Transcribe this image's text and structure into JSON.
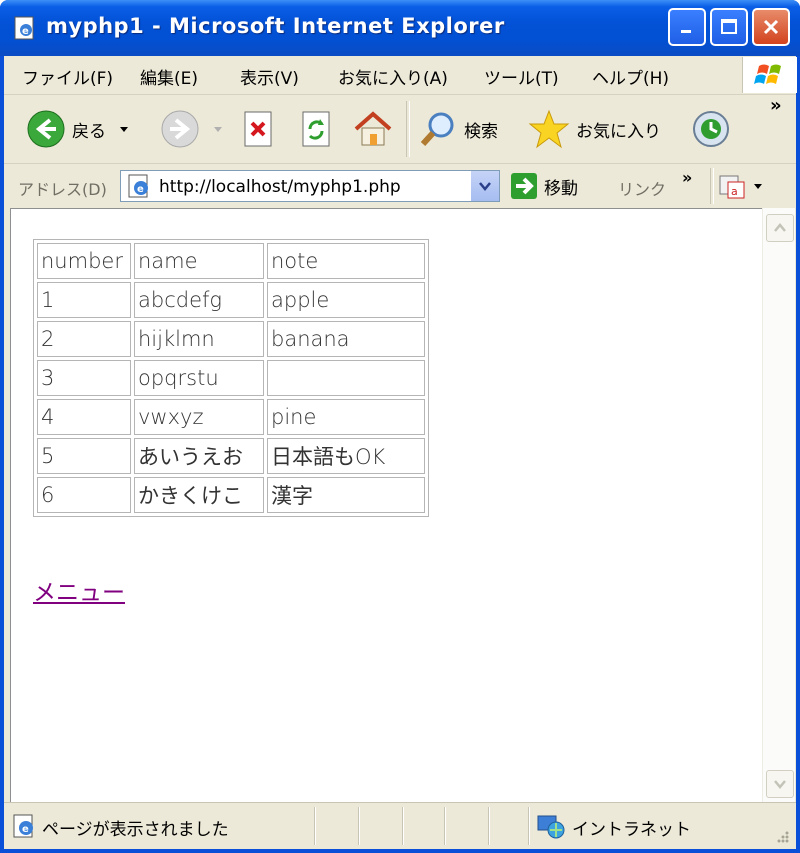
{
  "window": {
    "title": "myphp1 - Microsoft Internet Explorer"
  },
  "menu": [
    "ファイル(F)",
    "編集(E)",
    "表示(V)",
    "お気に入り(A)",
    "ツール(T)",
    "ヘルプ(H)"
  ],
  "toolbar": {
    "back": "戻る",
    "search": "検索",
    "favorites": "お気に入り",
    "more": "»"
  },
  "address": {
    "label": "アドレス(D)",
    "url": "http://localhost/myphp1.php",
    "go": "移動",
    "links": "リンク",
    "links_more": "»"
  },
  "table": {
    "rows": [
      [
        "number",
        "name",
        "note"
      ],
      [
        "1",
        "abcdefg",
        "apple"
      ],
      [
        "2",
        "hijklmn",
        "banana"
      ],
      [
        "3",
        "opqrstu",
        ""
      ],
      [
        "4",
        "vwxyz",
        "pine"
      ],
      [
        "5",
        "あいうえお",
        "日本語もOK"
      ],
      [
        "6",
        "かきくけこ",
        "漢字"
      ]
    ]
  },
  "link": {
    "label": "メニュー"
  },
  "status": {
    "text": "ページが表示されました",
    "zone": "イントラネット"
  },
  "colors": {
    "titlebar": "#0352d7",
    "chrome": "#ece9d8",
    "visited_link": "#800080"
  }
}
